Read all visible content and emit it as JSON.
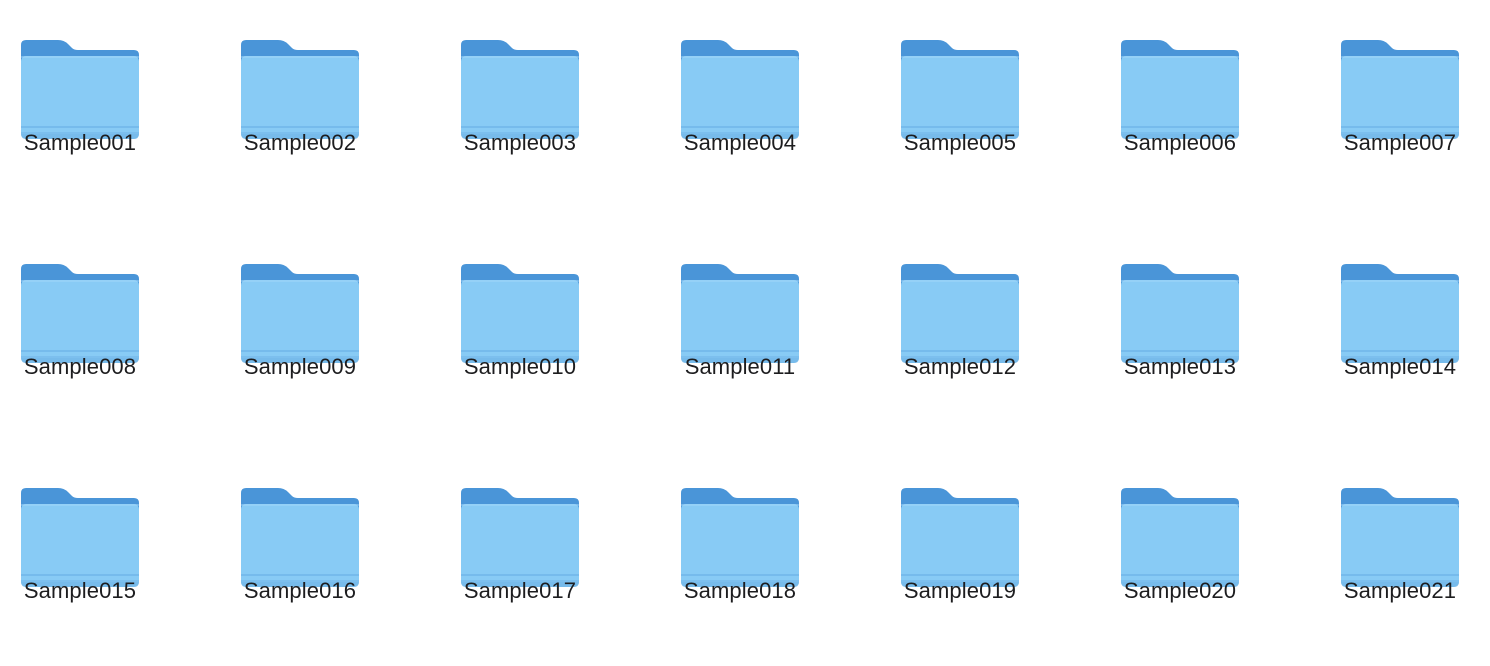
{
  "folder_icon": "folder-icon",
  "colors": {
    "folder_back": "#4a95d8",
    "folder_front": "#88cbf5",
    "folder_bottom": "#6fb4e8",
    "label_text": "#1d1d1f",
    "background": "#ffffff"
  },
  "folders": [
    {
      "name": "Sample001"
    },
    {
      "name": "Sample002"
    },
    {
      "name": "Sample003"
    },
    {
      "name": "Sample004"
    },
    {
      "name": "Sample005"
    },
    {
      "name": "Sample006"
    },
    {
      "name": "Sample007"
    },
    {
      "name": "Sample008"
    },
    {
      "name": "Sample009"
    },
    {
      "name": "Sample010"
    },
    {
      "name": "Sample011"
    },
    {
      "name": "Sample012"
    },
    {
      "name": "Sample013"
    },
    {
      "name": "Sample014"
    },
    {
      "name": "Sample015"
    },
    {
      "name": "Sample016"
    },
    {
      "name": "Sample017"
    },
    {
      "name": "Sample018"
    },
    {
      "name": "Sample019"
    },
    {
      "name": "Sample020"
    },
    {
      "name": "Sample021"
    }
  ]
}
